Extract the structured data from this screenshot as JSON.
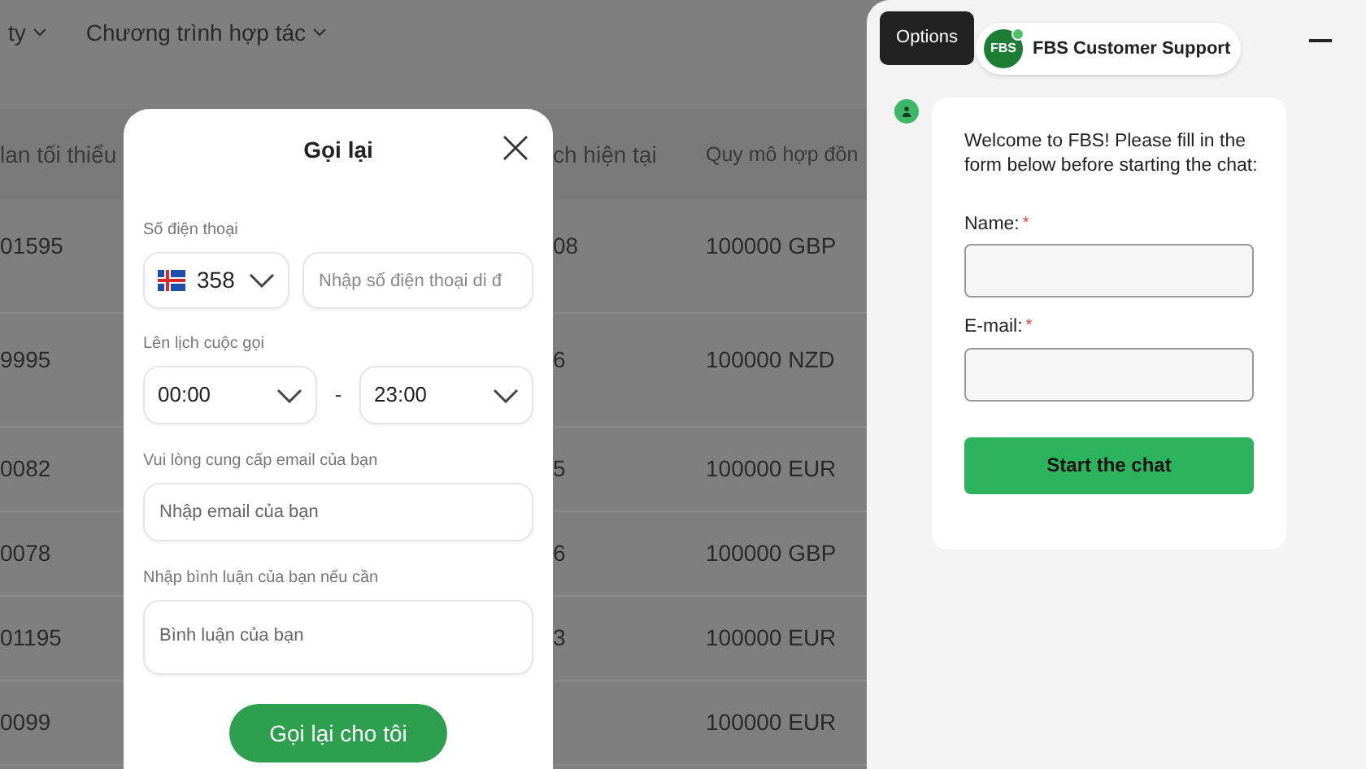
{
  "nav": [
    {
      "label": "ty"
    },
    {
      "label": "Chương trình hợp tác"
    }
  ],
  "table": {
    "columns": [
      {
        "label": "lan tối thiểu"
      },
      {
        "label": "ch hiện tại"
      },
      {
        "label": "Quy mô hợp đồn"
      }
    ],
    "rows": [
      {
        "column_1": "01595",
        "column_2": "08",
        "column_3": "100000 GBP"
      },
      {
        "column_1": "9995",
        "column_2": "6",
        "column_3": "100000 NZD"
      },
      {
        "column_1": "0082",
        "column_2": "5",
        "column_3": "100000 EUR"
      },
      {
        "column_1": "0078",
        "column_2": "6",
        "column_3": "100000 GBP"
      },
      {
        "column_1": "01195",
        "column_2": "3",
        "column_3": "100000 EUR"
      },
      {
        "column_1": "0099",
        "column_2": "",
        "column_3": "100000 EUR"
      }
    ]
  },
  "callback_dialog": {
    "title": "Gọi lại",
    "phone_label": "Số điện thoại",
    "country_code": "358",
    "phone_placeholder": "Nhập số điện thoại di đ",
    "schedule_label": "Lên lịch cuộc gọi",
    "time_from": "00:00",
    "separator": "-",
    "time_to": "23:00",
    "email_label": "Vui lòng cung cấp email của bạn",
    "email_placeholder": "Nhập email của bạn",
    "comment_label": "Nhập bình luận của bạn nếu cần",
    "comment_placeholder": "Bình luận của bạn",
    "submit": "Gọi lại cho tôi"
  },
  "chat": {
    "tooltip": "Options",
    "logo": "FBS",
    "title": "FBS Customer Support",
    "online": true,
    "welcome": "Welcome to FBS! Please fill in the form below before starting the chat:",
    "fields": [
      {
        "label": "Name:",
        "required": true,
        "required_mark": "*"
      },
      {
        "label": "E-mail:",
        "required": true,
        "required_mark": "*"
      }
    ],
    "start_button": "Start the chat"
  }
}
